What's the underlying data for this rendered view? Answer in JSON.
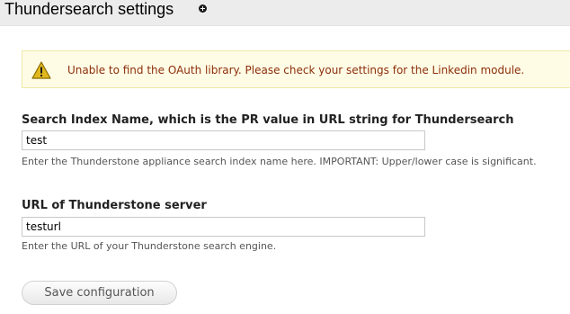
{
  "page": {
    "title": "Thundersearch settings"
  },
  "warning": {
    "message": "Unable to find the OAuth library. Please check your settings for the Linkedin module."
  },
  "form": {
    "index_name": {
      "label": "Search Index Name, which is the PR value in URL string for Thundersearch",
      "value": "test",
      "description": "Enter the Thunderstone appliance search index name here. IMPORTANT: Upper/lower case is significant."
    },
    "server_url": {
      "label": "URL of Thunderstone server",
      "value": "testurl",
      "description": "Enter the URL of your Thunderstone search engine."
    },
    "submit_label": "Save configuration"
  },
  "colors": {
    "warning_background": "#fffce5",
    "warning_text": "#8c2e0b",
    "warning_icon": "#e0b81e"
  },
  "icons": {
    "title_icon": "add-shortcut-icon",
    "warning_icon": "warning-icon"
  }
}
